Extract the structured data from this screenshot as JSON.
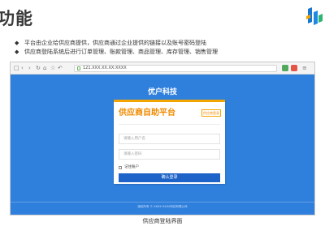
{
  "slide": {
    "title": "功能",
    "bullet_mark": "◆",
    "bullets": [
      "平台由企业给供应商提供，供应商通过企业提供的链接以及账号密码登陆",
      "供应商登陆系统后进行订单管理、账款管理、商品管理、库存管理、销售管理"
    ],
    "caption": "供应商登陆界面"
  },
  "browser": {
    "url": "121.XXX.XX.XX:XXXX",
    "icons": [
      "window-icon",
      "back-icon",
      "forward-icon",
      "refresh-icon",
      "home-icon",
      "star-icon",
      "undo-icon",
      "address-lock-icon",
      "extension-icon",
      "shield-icon",
      "menu-icon"
    ]
  },
  "login_page": {
    "company_name": "优户科技",
    "card_title": "供应商自助平台",
    "card_tag": "供应商登录",
    "username_placeholder": "请输入用户名",
    "password_placeholder": "请输入密码",
    "remember_label": "记住账户",
    "login_button": "确认登录",
    "footer": "版权所有 © XXXX    XXXX科技有限公司"
  },
  "colors": {
    "page_background": "#2F7FDD",
    "login_button": "#1E63C7",
    "accent_orange": "#F08A00"
  }
}
